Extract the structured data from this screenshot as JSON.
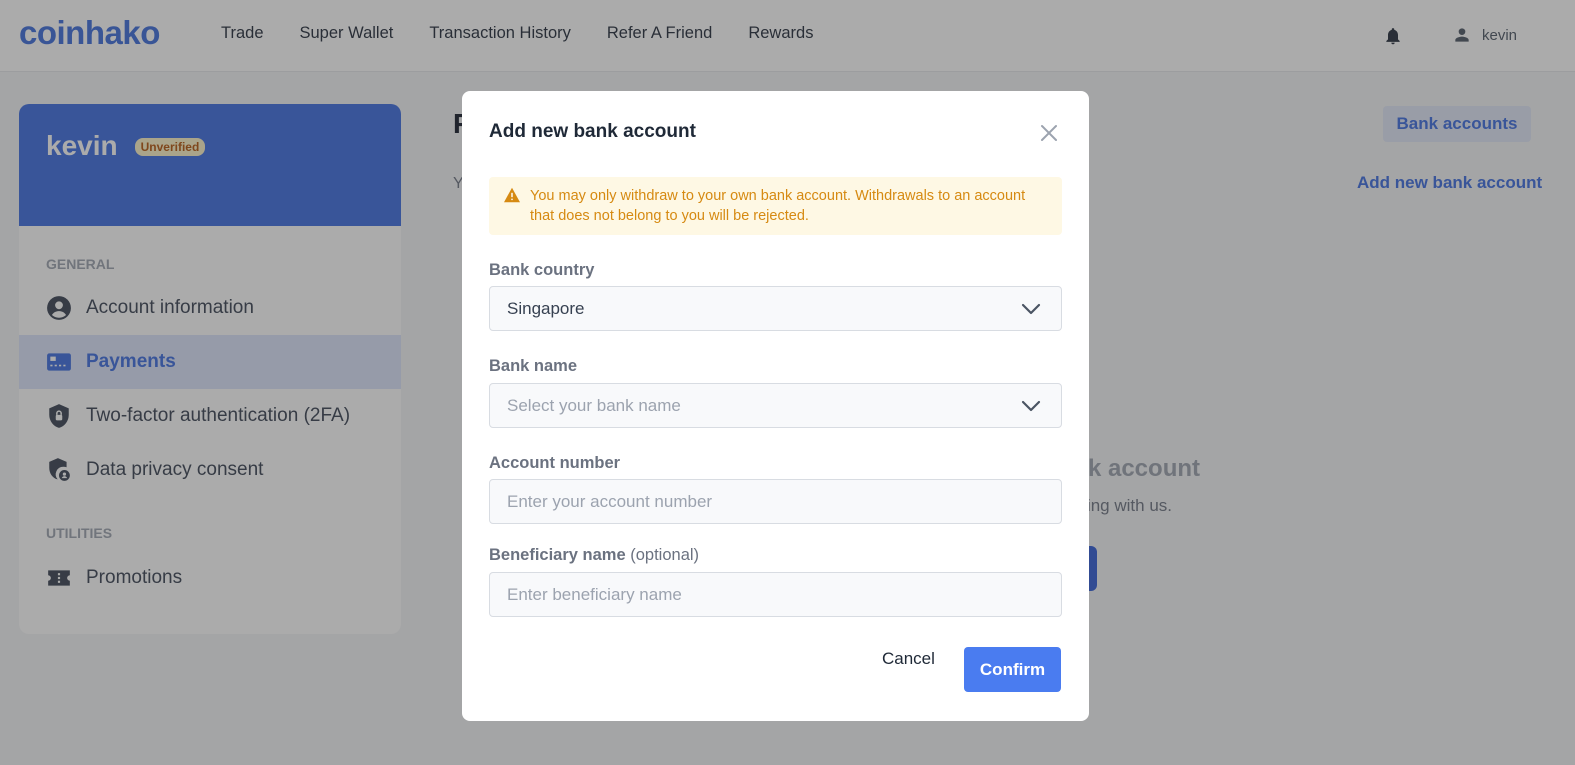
{
  "header": {
    "logo": "coinhako",
    "nav": [
      "Trade",
      "Super Wallet",
      "Transaction History",
      "Refer A Friend",
      "Rewards"
    ],
    "username": "kevin",
    "icons": {
      "notifications": "bell-icon",
      "profile": "user-icon"
    }
  },
  "sidebar": {
    "username": "kevin",
    "status_badge": "Unverified",
    "sections": [
      {
        "label": "GENERAL",
        "items": [
          {
            "label": "Account information",
            "icon": "account-circle-icon",
            "active": false
          },
          {
            "label": "Payments",
            "icon": "credit-card-icon",
            "active": true
          },
          {
            "label": "Two-factor authentication (2FA)",
            "icon": "shield-lock-icon",
            "active": false
          },
          {
            "label": "Data privacy consent",
            "icon": "shield-user-icon",
            "active": false
          }
        ]
      },
      {
        "label": "UTILITIES",
        "items": [
          {
            "label": "Promotions",
            "icon": "ticket-icon",
            "active": false
          }
        ]
      }
    ]
  },
  "main": {
    "title_partial": "P",
    "subtitle_partial": "Y",
    "tab_label": "Bank accounts",
    "add_link": "Add new bank account",
    "empty_title_partial": "k account",
    "empty_sub_partial": "ing with us."
  },
  "modal": {
    "title": "Add new bank account",
    "alert": "You may only withdraw to your own bank account. Withdrawals to an account that does not belong to you will be rejected.",
    "fields": {
      "country": {
        "label": "Bank country",
        "value": "Singapore"
      },
      "bank_name": {
        "label": "Bank name",
        "placeholder": "Select your bank name"
      },
      "account_number": {
        "label": "Account number",
        "placeholder": "Enter your account number"
      },
      "beneficiary": {
        "label": "Beneficiary name",
        "label_suffix": "(optional)",
        "placeholder": "Enter beneficiary name"
      }
    },
    "cancel_label": "Cancel",
    "confirm_label": "Confirm"
  },
  "colors": {
    "brand": "#3b6cdb",
    "primary_button": "#4a7cf0",
    "alert_bg": "#fef8e4",
    "alert_text": "#d68a12"
  }
}
